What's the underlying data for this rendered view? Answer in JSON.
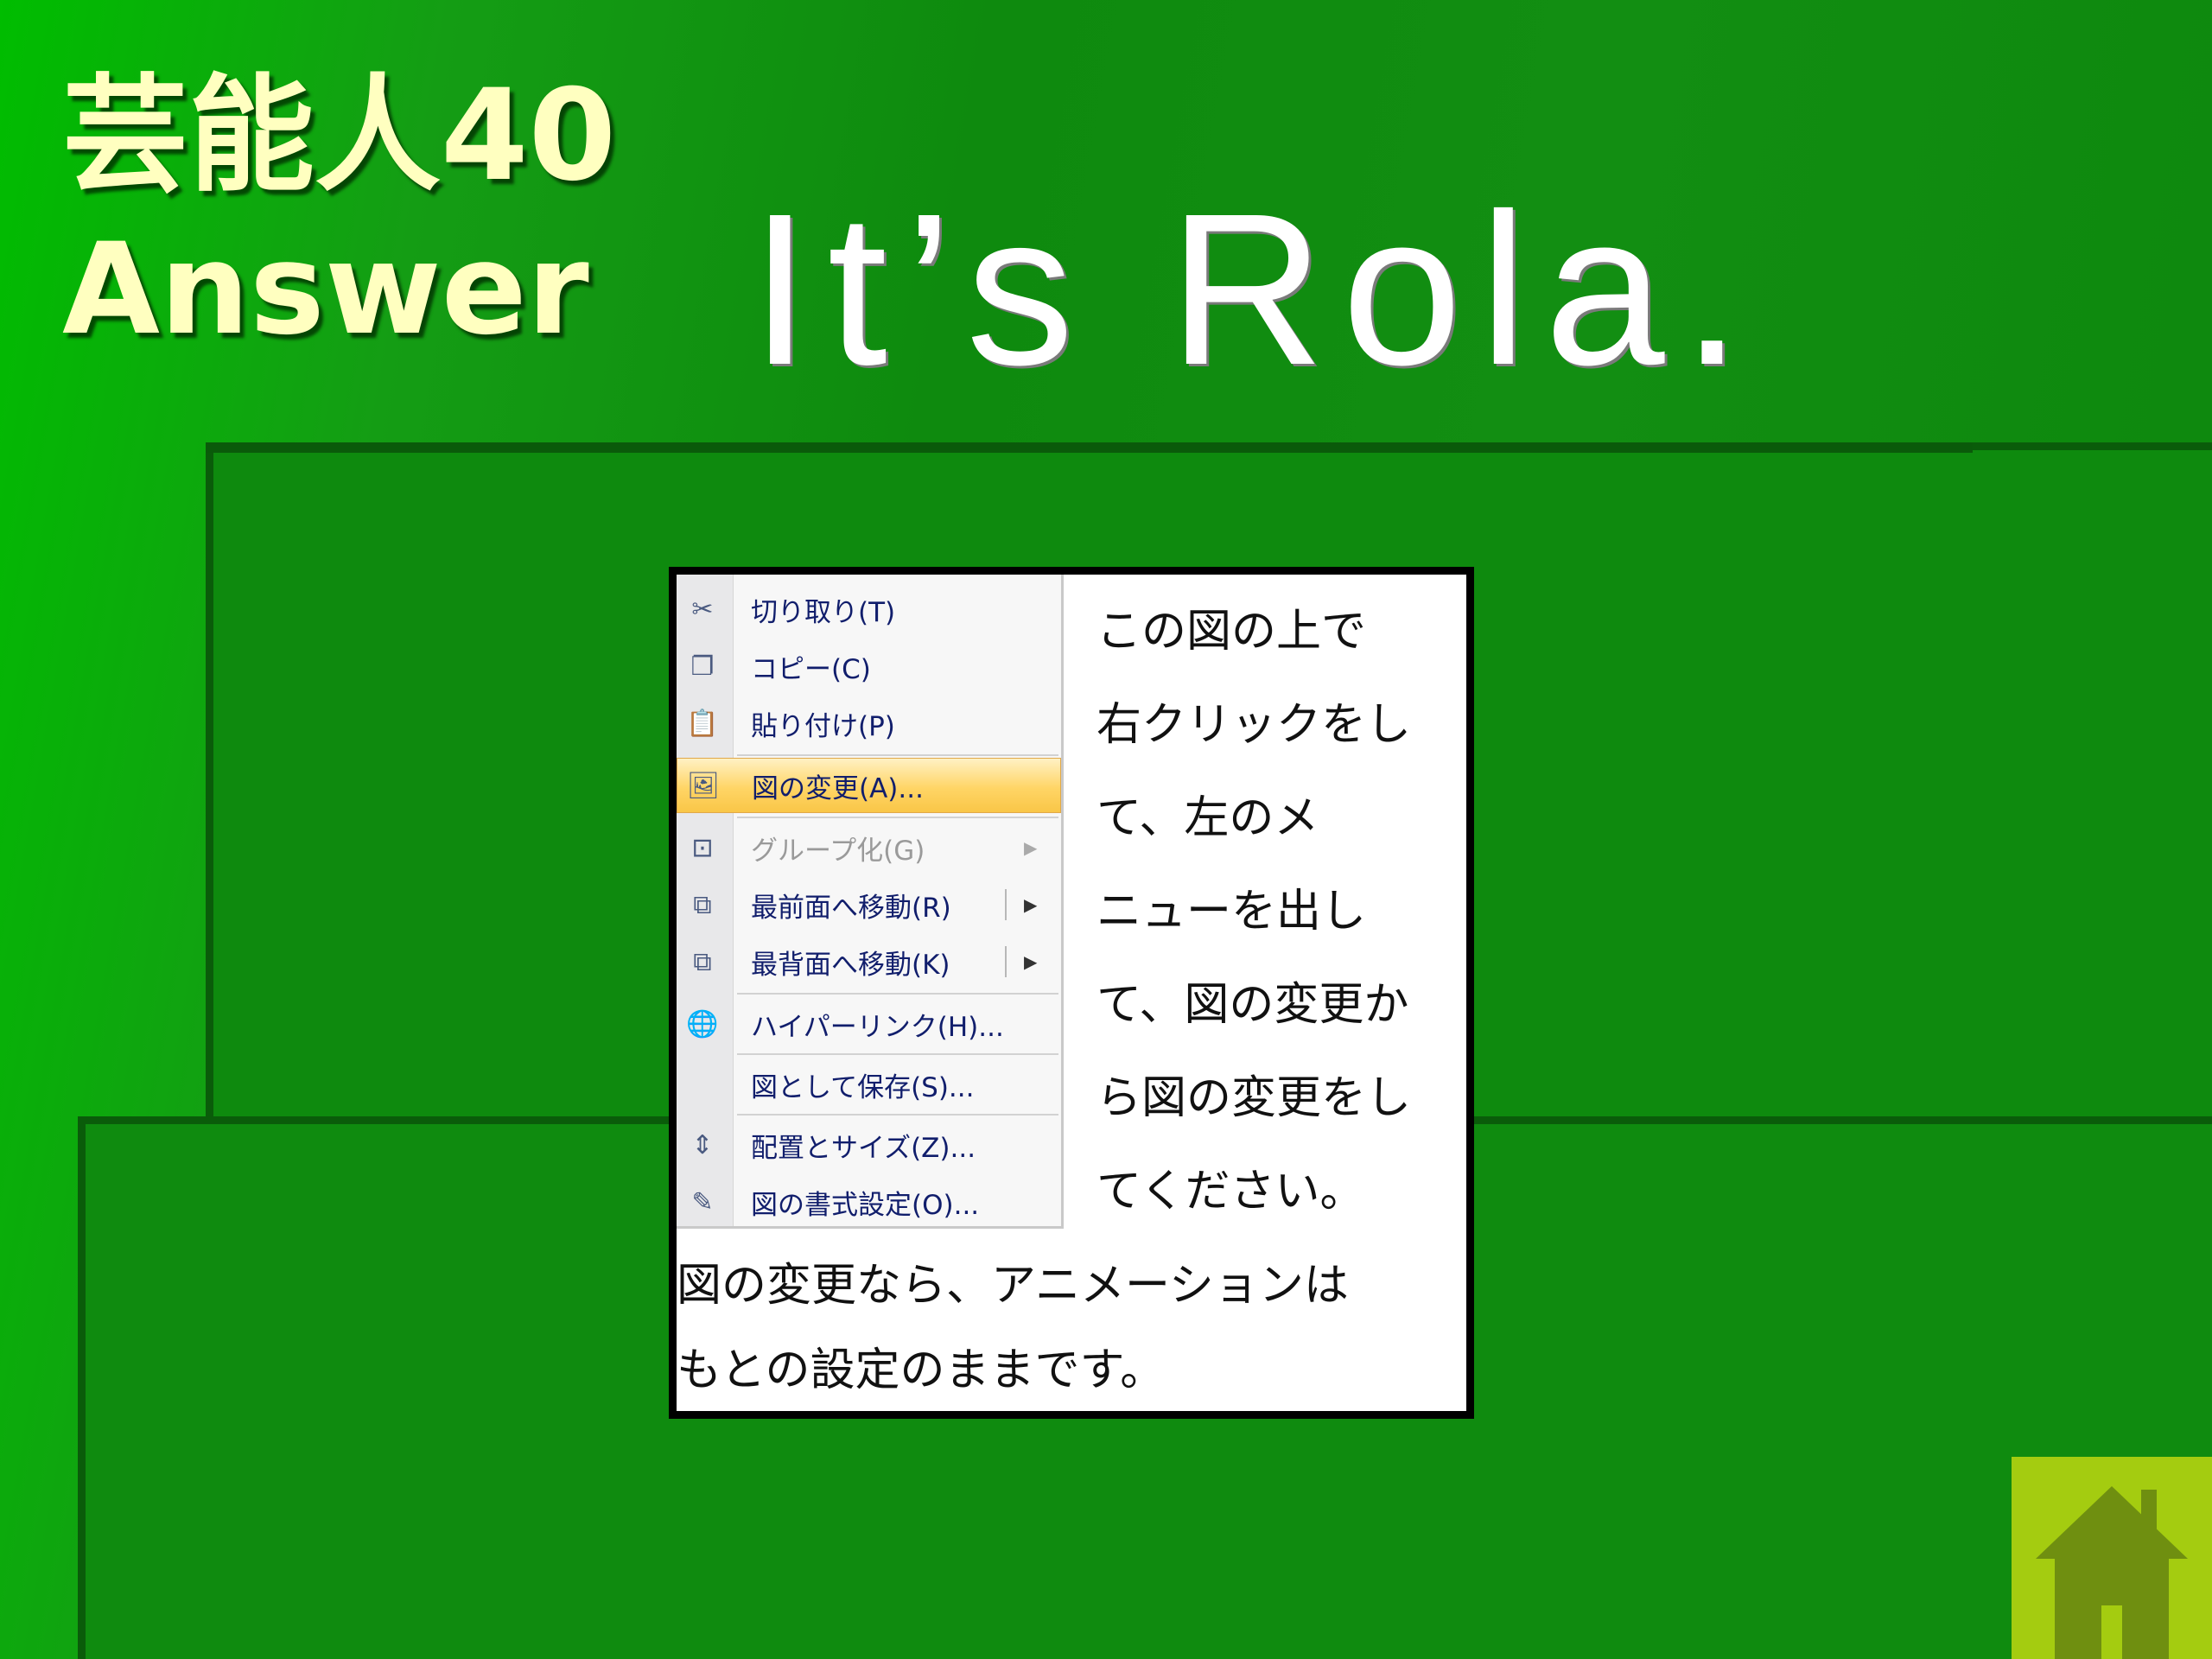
{
  "slide": {
    "title_line1": "芸能人40",
    "title_line2": "Answer",
    "answer": "It’s Rola."
  },
  "context_menu": {
    "items": [
      {
        "label": "切り取り(T)",
        "icon": "scissors-icon",
        "enabled": true
      },
      {
        "label": "コピー(C)",
        "icon": "copy-icon",
        "enabled": true
      },
      {
        "label": "貼り付け(P)",
        "icon": "paste-icon",
        "enabled": true
      },
      {
        "label": "図の変更(A)...",
        "icon": "change-picture-icon",
        "enabled": true,
        "highlighted": true
      },
      {
        "label": "グループ化(G)",
        "icon": "group-icon",
        "enabled": false,
        "submenu": true
      },
      {
        "label": "最前面へ移動(R)",
        "icon": "bring-to-front-icon",
        "enabled": true,
        "submenu": true
      },
      {
        "label": "最背面へ移動(K)",
        "icon": "send-to-back-icon",
        "enabled": true,
        "submenu": true
      },
      {
        "label": "ハイパーリンク(H)...",
        "icon": "hyperlink-icon",
        "enabled": true
      },
      {
        "label": "図として保存(S)...",
        "icon": "",
        "enabled": true
      },
      {
        "label": "配置とサイズ(Z)...",
        "icon": "size-position-icon",
        "enabled": true
      },
      {
        "label": "図の書式設定(O)...",
        "icon": "format-picture-icon",
        "enabled": true
      }
    ]
  },
  "instructions": {
    "lines": [
      "この図の上で",
      "右クリックをし",
      "て、左のメ",
      "ニューを出し",
      "て、図の変更か",
      "ら図の変更をし",
      "てください。"
    ]
  },
  "note": {
    "lines": [
      "図の変更なら、アニメーションは",
      "もとの設定のままです。"
    ]
  },
  "home_button": {
    "icon": "home-icon",
    "background": "#a4cc10",
    "house_color": "#6f8f10"
  }
}
